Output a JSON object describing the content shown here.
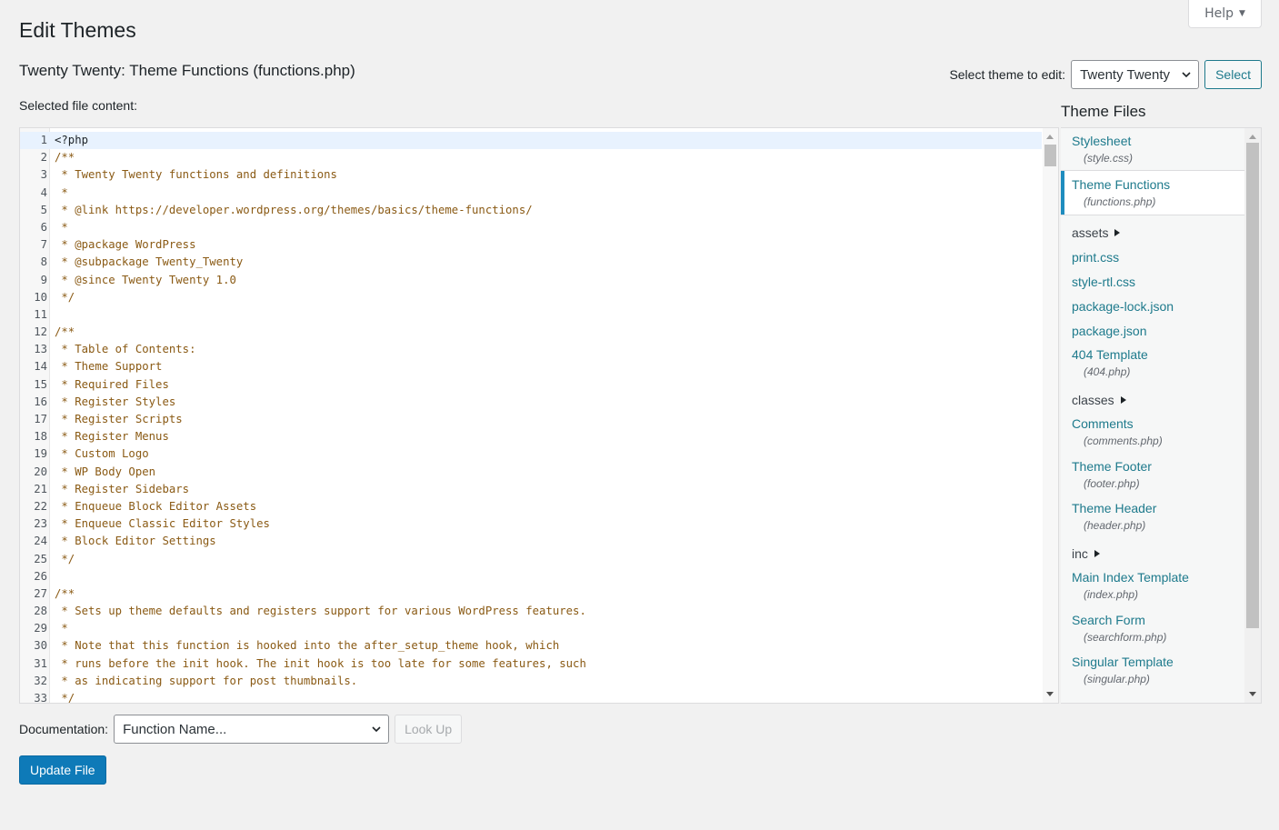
{
  "header": {
    "help_label": "Help",
    "page_title": "Edit Themes",
    "file_title": "Twenty Twenty: Theme Functions (functions.php)",
    "selected_label": "Selected file content:"
  },
  "theme_select": {
    "label": "Select theme to edit:",
    "value": "Twenty Twenty",
    "button": "Select"
  },
  "editor": {
    "active_line": 1,
    "lines": [
      {
        "n": "1",
        "text": "<?php",
        "kind": "plain"
      },
      {
        "n": "2",
        "text": "/**",
        "kind": "comment"
      },
      {
        "n": "3",
        "text": " * Twenty Twenty functions and definitions",
        "kind": "comment"
      },
      {
        "n": "4",
        "text": " *",
        "kind": "comment"
      },
      {
        "n": "5",
        "text": " * @link https://developer.wordpress.org/themes/basics/theme-functions/",
        "kind": "comment"
      },
      {
        "n": "6",
        "text": " *",
        "kind": "comment"
      },
      {
        "n": "7",
        "text": " * @package WordPress",
        "kind": "comment"
      },
      {
        "n": "8",
        "text": " * @subpackage Twenty_Twenty",
        "kind": "comment"
      },
      {
        "n": "9",
        "text": " * @since Twenty Twenty 1.0",
        "kind": "comment"
      },
      {
        "n": "10",
        "text": " */",
        "kind": "comment"
      },
      {
        "n": "11",
        "text": "",
        "kind": "plain"
      },
      {
        "n": "12",
        "text": "/**",
        "kind": "comment"
      },
      {
        "n": "13",
        "text": " * Table of Contents:",
        "kind": "comment"
      },
      {
        "n": "14",
        "text": " * Theme Support",
        "kind": "comment"
      },
      {
        "n": "15",
        "text": " * Required Files",
        "kind": "comment"
      },
      {
        "n": "16",
        "text": " * Register Styles",
        "kind": "comment"
      },
      {
        "n": "17",
        "text": " * Register Scripts",
        "kind": "comment"
      },
      {
        "n": "18",
        "text": " * Register Menus",
        "kind": "comment"
      },
      {
        "n": "19",
        "text": " * Custom Logo",
        "kind": "comment"
      },
      {
        "n": "20",
        "text": " * WP Body Open",
        "kind": "comment"
      },
      {
        "n": "21",
        "text": " * Register Sidebars",
        "kind": "comment"
      },
      {
        "n": "22",
        "text": " * Enqueue Block Editor Assets",
        "kind": "comment"
      },
      {
        "n": "23",
        "text": " * Enqueue Classic Editor Styles",
        "kind": "comment"
      },
      {
        "n": "24",
        "text": " * Block Editor Settings",
        "kind": "comment"
      },
      {
        "n": "25",
        "text": " */",
        "kind": "comment"
      },
      {
        "n": "26",
        "text": "",
        "kind": "plain"
      },
      {
        "n": "27",
        "text": "/**",
        "kind": "comment"
      },
      {
        "n": "28",
        "text": " * Sets up theme defaults and registers support for various WordPress features.",
        "kind": "comment"
      },
      {
        "n": "29",
        "text": " *",
        "kind": "comment"
      },
      {
        "n": "30",
        "text": " * Note that this function is hooked into the after_setup_theme hook, which",
        "kind": "comment"
      },
      {
        "n": "31",
        "text": " * runs before the init hook. The init hook is too late for some features, such",
        "kind": "comment"
      },
      {
        "n": "32",
        "text": " * as indicating support for post thumbnails.",
        "kind": "comment"
      },
      {
        "n": "33",
        "text": " */",
        "kind": "comment"
      }
    ]
  },
  "files": {
    "heading": "Theme Files",
    "items": [
      {
        "type": "file",
        "name": "Stylesheet",
        "file": "(style.css)"
      },
      {
        "type": "file",
        "name": "Theme Functions",
        "file": "(functions.php)",
        "active": true
      },
      {
        "type": "folder",
        "name": "assets"
      },
      {
        "type": "file",
        "name": "print.css"
      },
      {
        "type": "file",
        "name": "style-rtl.css"
      },
      {
        "type": "file",
        "name": "package-lock.json"
      },
      {
        "type": "file",
        "name": "package.json"
      },
      {
        "type": "file",
        "name": "404 Template",
        "file": "(404.php)"
      },
      {
        "type": "folder",
        "name": "classes"
      },
      {
        "type": "file",
        "name": "Comments",
        "file": "(comments.php)"
      },
      {
        "type": "file",
        "name": "Theme Footer",
        "file": "(footer.php)"
      },
      {
        "type": "file",
        "name": "Theme Header",
        "file": "(header.php)"
      },
      {
        "type": "folder",
        "name": "inc"
      },
      {
        "type": "file",
        "name": "Main Index Template",
        "file": "(index.php)"
      },
      {
        "type": "file",
        "name": "Search Form",
        "file": "(searchform.php)"
      },
      {
        "type": "file",
        "name": "Singular Template",
        "file": "(singular.php)"
      }
    ]
  },
  "documentation": {
    "label": "Documentation:",
    "placeholder": "Function Name...",
    "lookup_button": "Look Up"
  },
  "actions": {
    "update_button": "Update File"
  },
  "colors": {
    "accent": "#2271b1",
    "primary_button": "#0e7ab8",
    "comment_text": "#8a5a14",
    "active_file_border": "#1e8cbe"
  }
}
